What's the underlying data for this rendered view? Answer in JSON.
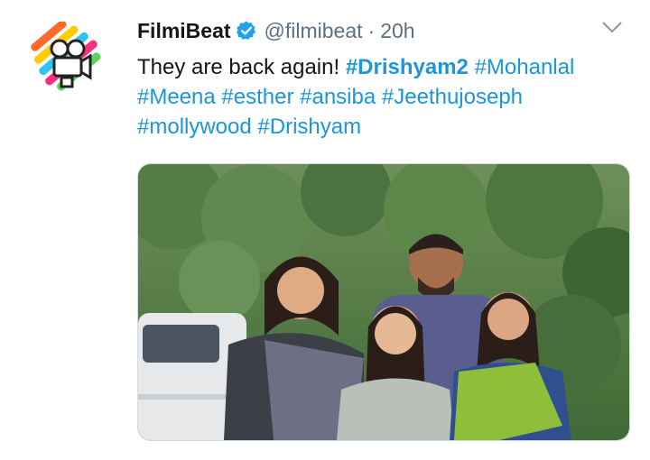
{
  "account": {
    "name": "FilmiBeat",
    "handle": "@filmibeat",
    "separator": "·",
    "time": "20h",
    "verified": true
  },
  "tweet": {
    "text": "They are back again!",
    "hashtags": [
      "#Drishyam2",
      "#Mohanlal",
      "#Meena",
      "#esther",
      "#ansiba",
      "#Jeethujoseph",
      "#mollywood",
      "#Drishyam"
    ]
  },
  "icons": {
    "avatar": "filmibeat-logo",
    "verified": "verified-badge-icon",
    "menu": "chevron-down-icon"
  },
  "colors": {
    "link": "#1b95e0",
    "verified": "#1da1f2",
    "secondary_text": "#5b7083"
  }
}
